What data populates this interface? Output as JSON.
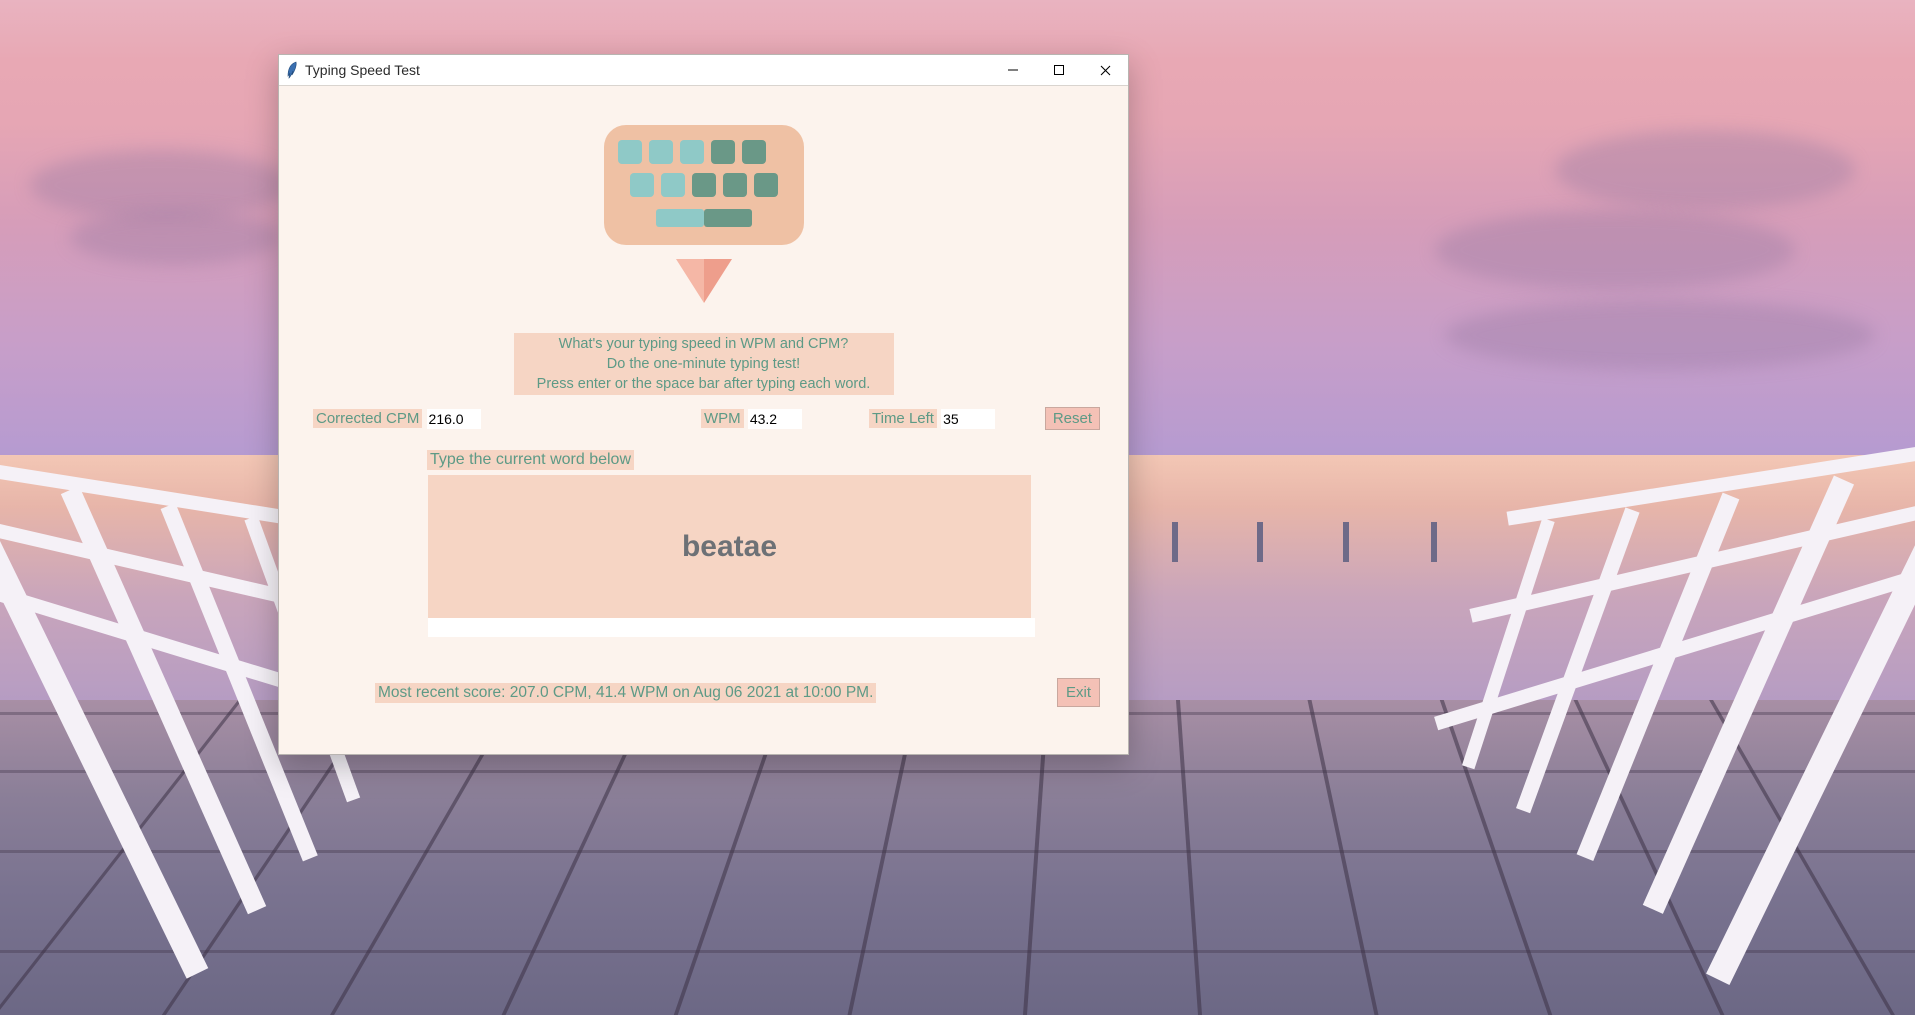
{
  "window": {
    "title": "Typing Speed Test"
  },
  "intro": {
    "line1": "What's your typing speed in WPM and CPM?",
    "line2": "Do the one-minute typing test!",
    "line3": "Press enter or the space bar after typing each word."
  },
  "stats": {
    "cpm_label": "Corrected CPM",
    "cpm_value": "216.0",
    "wpm_label": "WPM",
    "wpm_value": "43.2",
    "time_label": "Time Left",
    "time_value": "35",
    "reset_label": "Reset"
  },
  "typing": {
    "prompt_label": "Type the current word below",
    "current_word": "beatae",
    "entry_value": ""
  },
  "footer": {
    "score_text": "Most recent score: 207.0 CPM, 41.4 WPM on Aug 06 2021 at 10:00 PM.",
    "exit_label": "Exit"
  }
}
